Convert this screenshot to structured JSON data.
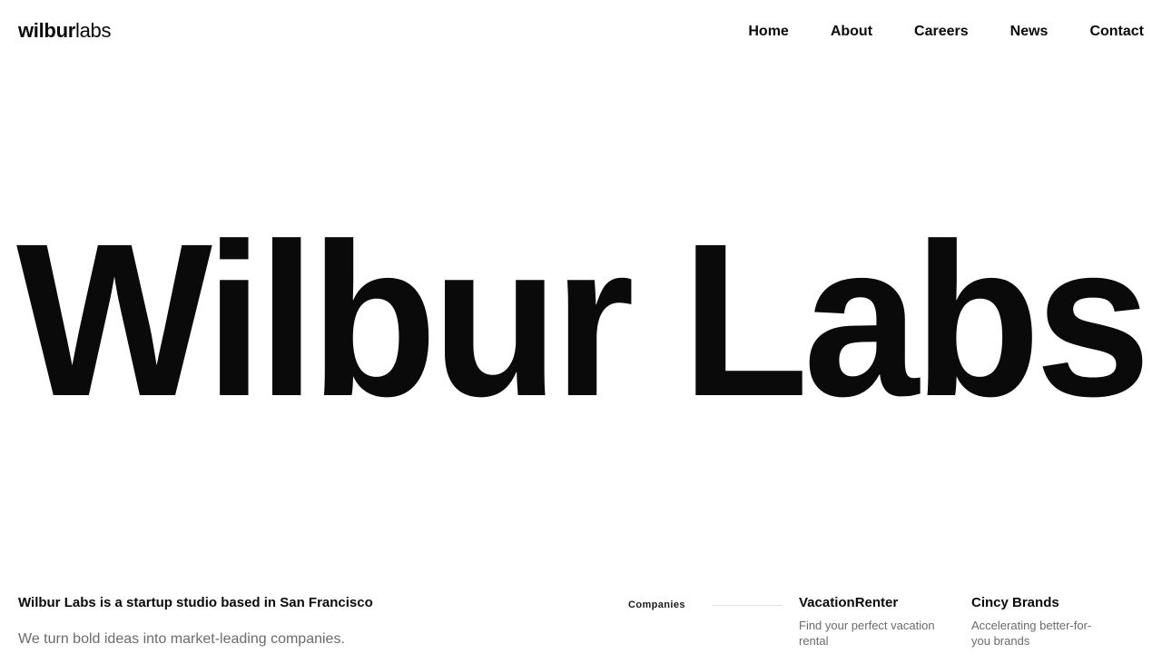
{
  "header": {
    "logo_bold": "wilbur",
    "logo_light": "labs",
    "nav": [
      "Home",
      "About",
      "Careers",
      "News",
      "Contact"
    ]
  },
  "hero": {
    "wordmark": "Wilbur Labs"
  },
  "intro": {
    "tagline": "Wilbur Labs is a startup studio based in San Francisco",
    "subtext": "We turn bold ideas into market-leading companies."
  },
  "companies": {
    "label": "Companies",
    "items": [
      {
        "name": "VacationRenter",
        "desc": "Find your perfect vacation rental"
      },
      {
        "name": "Cincy Brands",
        "desc": "Accelerating better-for-you brands"
      }
    ]
  },
  "colors": {
    "text": "#0a0a0a",
    "muted": "#6b6b6b",
    "rule": "#e3e3e3",
    "background": "#ffffff"
  }
}
